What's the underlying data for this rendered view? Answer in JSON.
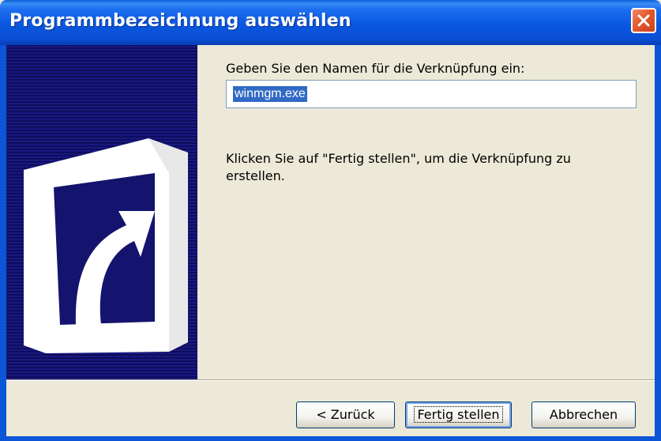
{
  "window": {
    "title": "Programmbezeichnung auswählen"
  },
  "form": {
    "prompt": "Geben Sie den Namen für die Verknüpfung ein:",
    "name_value": "winmgm.exe",
    "instruction": "Klicken Sie auf \"Fertig stellen\", um die Verknüpfung zu erstellen."
  },
  "buttons": {
    "back": "< Zurück",
    "finish": "Fertig stellen",
    "cancel": "Abbrechen"
  },
  "icons": {
    "close": "close-icon",
    "banner": "shortcut-arrow-icon"
  },
  "colors": {
    "titlebar": "#0a57e0",
    "banner": "#14136e",
    "dialog_bg": "#ece9d8",
    "selection": "#316ac5",
    "close": "#e45a2e"
  }
}
